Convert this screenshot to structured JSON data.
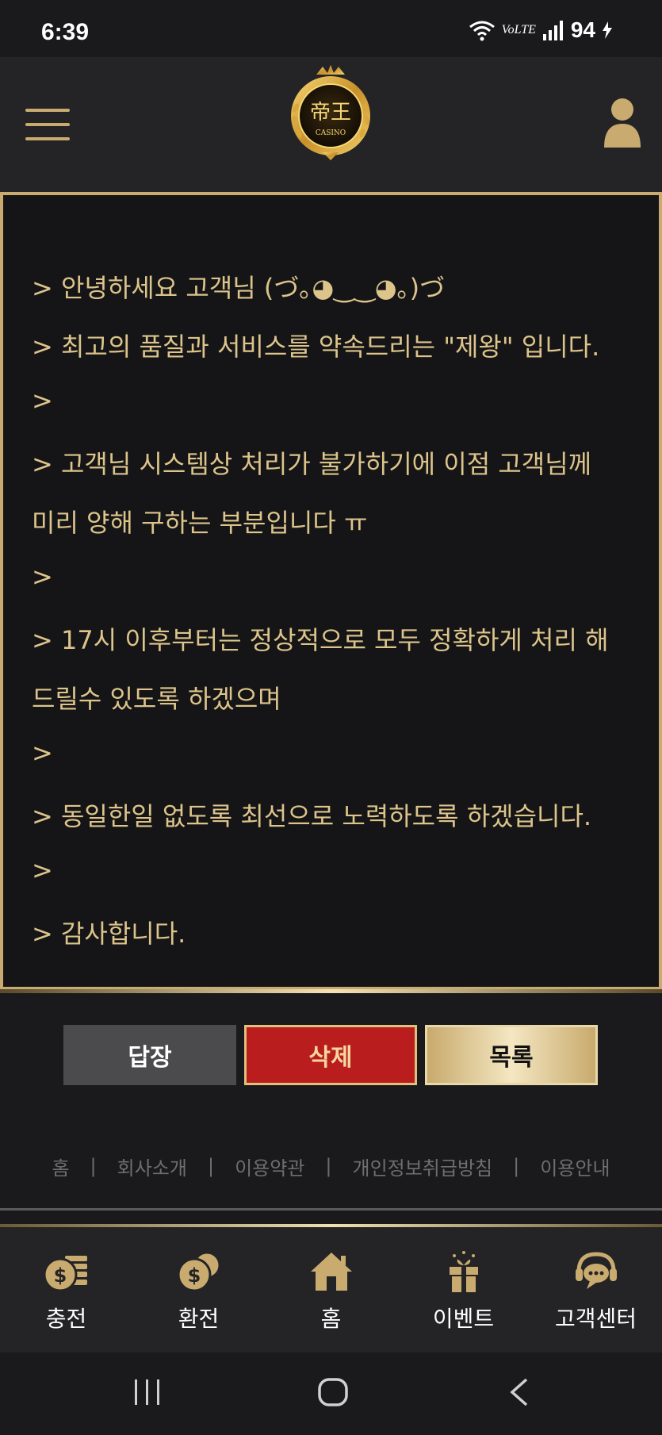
{
  "status_bar": {
    "time": "6:39",
    "network": "VoLTE",
    "battery": "94"
  },
  "header": {
    "logo_text": "帝王",
    "logo_sub": "CASINO"
  },
  "message": {
    "lines": [
      "> 안녕하세요 고객님 (づ｡◕‿‿◕｡)づ",
      "> 최고의 품질과 서비스를 약속드리는 \"제왕\" 입니다.",
      ">",
      "> 고객님 시스템상 처리가 불가하기에 이점 고객님께",
      "미리 양해 구하는 부분입니다 ㅠ",
      ">",
      "> 17시 이후부터는 정상적으로 모두 정확하게 처리 해",
      "드릴수 있도록 하겠으며",
      ">",
      "> 동일한일 없도록 최선으로 노력하도록 하겠습니다.",
      ">",
      "> 감사합니다."
    ]
  },
  "buttons": {
    "reply": "답장",
    "delete": "삭제",
    "list": "목록"
  },
  "footer": {
    "links": [
      "홈",
      "회사소개",
      "이용약관",
      "개인정보취급방침",
      "이용안내"
    ],
    "separator": "|"
  },
  "bottom_nav": {
    "items": [
      {
        "label": "충전",
        "icon": "charge-coins-icon"
      },
      {
        "label": "환전",
        "icon": "exchange-coins-icon"
      },
      {
        "label": "홈",
        "icon": "home-icon"
      },
      {
        "label": "이벤트",
        "icon": "gift-icon"
      },
      {
        "label": "고객센터",
        "icon": "support-chat-icon"
      }
    ]
  },
  "colors": {
    "gold": "#c9ab70",
    "text_gold": "#dcc48b",
    "delete_red": "#b91d1d",
    "background": "#151517"
  }
}
